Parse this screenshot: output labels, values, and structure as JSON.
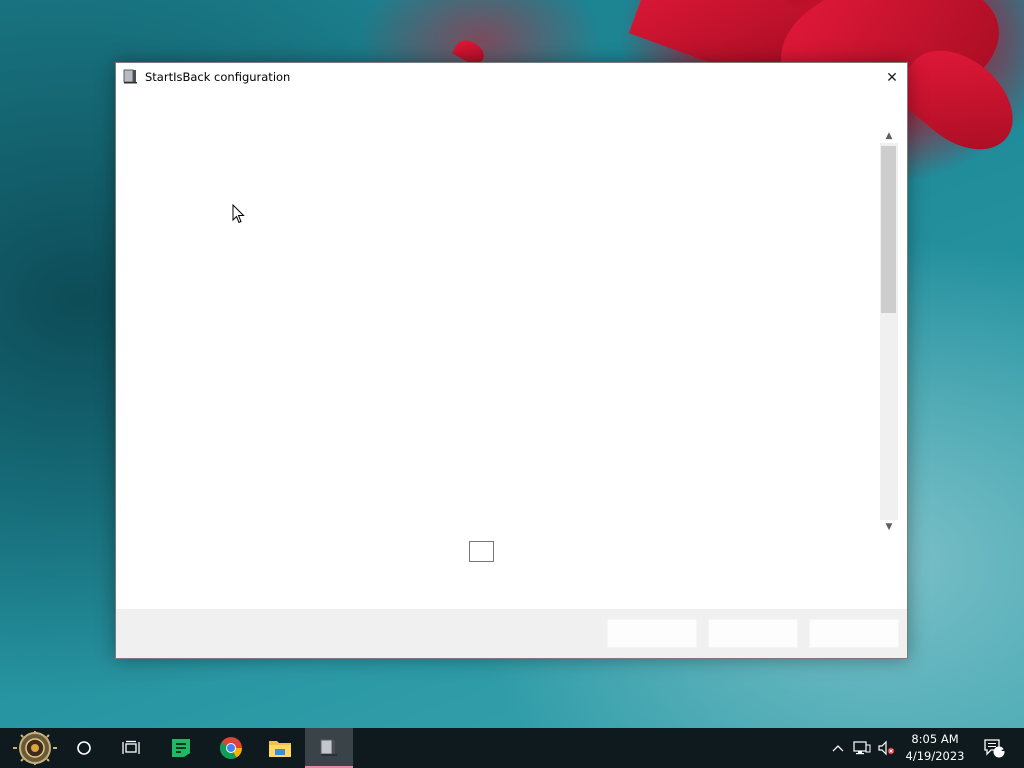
{
  "window": {
    "title": "StartIsBack configuration",
    "close_glyph": "✕",
    "scroll_up_glyph": "▲",
    "scroll_down_glyph": "▼",
    "scroll_thumb_fraction": 0.45
  },
  "taskbar": {
    "items": [
      {
        "name": "start-orb-icon"
      },
      {
        "name": "search-circle-icon"
      },
      {
        "name": "task-view-icon"
      },
      {
        "name": "notes-app-icon"
      },
      {
        "name": "chrome-icon"
      },
      {
        "name": "file-explorer-icon"
      },
      {
        "name": "startisback-config-icon",
        "active": true
      }
    ],
    "clock": {
      "time": "8:05 AM",
      "date": "4/19/2023"
    },
    "notification_count": "1",
    "tray_up_glyph": "^"
  },
  "colors": {
    "accent_active": "#e58ba0",
    "taskbar_bg": "#0f1a1e"
  }
}
